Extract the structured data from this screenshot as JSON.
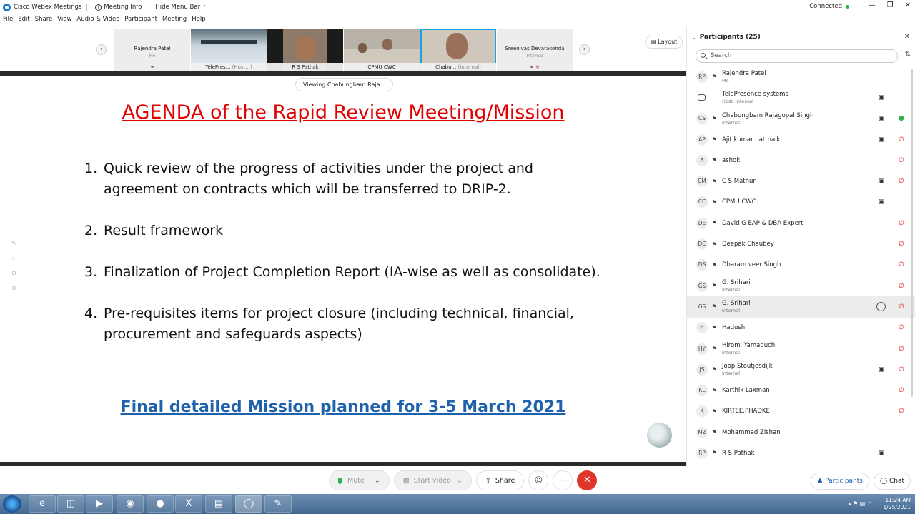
{
  "titlebar": {
    "app_name": "Cisco Webex Meetings",
    "meeting_info": "Meeting Info",
    "hide_menu": "Hide Menu Bar",
    "connection": "Connected"
  },
  "menu": [
    "File",
    "Edit",
    "Share",
    "View",
    "Audio & Video",
    "Participant",
    "Meeting",
    "Help"
  ],
  "filmstrip": {
    "tiles": [
      {
        "name": "Rajendra Patel",
        "sub": "Me"
      },
      {
        "name": "TelePres...",
        "sub": "(Host...)"
      },
      {
        "name": "R S Pathak",
        "sub": ""
      },
      {
        "name": "CPMU CWC",
        "sub": ""
      },
      {
        "name": "Chabu...",
        "sub": "(Internal)"
      },
      {
        "name": "Sreenivas Devarakonda",
        "sub": "Internal"
      }
    ],
    "layout_label": "Layout"
  },
  "viewing_label": "Viewing Chabungbam Raja...",
  "slide": {
    "title": "AGENDA of the Rapid Review Meeting/Mission",
    "items": [
      {
        "num": "1.",
        "text": "Quick review of the progress of activities under the project and agreement on contracts which will be transferred to DRIP-2."
      },
      {
        "num": "2.",
        "text": "Result framework"
      },
      {
        "num": "3.",
        "text": "Finalization of Project Completion Report (IA-wise as well as consolidate)."
      },
      {
        "num": "4.",
        "text": "Pre-requisites items for project closure (including technical, financial, procurement and safeguards aspects)"
      }
    ],
    "footer": "Final detailed Mission planned for 3-5 March 2021"
  },
  "controls": {
    "mute": "Mute",
    "start_video": "Start video",
    "share": "Share"
  },
  "participants": {
    "header": "Participants (25)",
    "search_placeholder": "Search",
    "list": [
      {
        "initials": "RP",
        "name": "Rajendra Patel",
        "sub": "Me",
        "video": false,
        "muted": false
      },
      {
        "initials": "",
        "name": "TelePresence systems",
        "sub": "Host, internal",
        "video": true,
        "muted": false
      },
      {
        "initials": "CS",
        "name": "Chabungbam Rajagopal Singh",
        "sub": "Internal",
        "video": true,
        "muted": false,
        "unmuted": true
      },
      {
        "initials": "AP",
        "name": "Ajit kumar pattnaik",
        "sub": "",
        "video": true,
        "muted": true
      },
      {
        "initials": "A",
        "name": "ashok",
        "sub": "",
        "video": false,
        "muted": true
      },
      {
        "initials": "CM",
        "name": "C S Mathur",
        "sub": "",
        "video": true,
        "muted": true
      },
      {
        "initials": "CC",
        "name": "CPMU CWC",
        "sub": "",
        "video": true,
        "muted": false
      },
      {
        "initials": "DE",
        "name": "David G EAP & DBA Expert",
        "sub": "",
        "video": false,
        "muted": true
      },
      {
        "initials": "DC",
        "name": "Deepak Chaubey",
        "sub": "",
        "video": false,
        "muted": true
      },
      {
        "initials": "DS",
        "name": "Dharam veer Singh",
        "sub": "",
        "video": false,
        "muted": true
      },
      {
        "initials": "GS",
        "name": "G. Srihari",
        "sub": "Internal",
        "video": false,
        "muted": true
      },
      {
        "initials": "GS",
        "name": "G. Srihari",
        "sub": "Internal",
        "video": false,
        "muted": true,
        "chat": true,
        "highlight": true
      },
      {
        "initials": "H",
        "name": "Hadush",
        "sub": "",
        "video": false,
        "muted": true
      },
      {
        "initials": "HY",
        "name": "Hiromi Yamaguchi",
        "sub": "Internal",
        "video": false,
        "muted": true
      },
      {
        "initials": "JS",
        "name": "Joop Stoutjesdijk",
        "sub": "Internal",
        "video": true,
        "muted": true
      },
      {
        "initials": "KL",
        "name": "Karthik Laxman",
        "sub": "",
        "video": false,
        "muted": true
      },
      {
        "initials": "K",
        "name": "KIRTEE.PHADKE",
        "sub": "",
        "video": false,
        "muted": true
      },
      {
        "initials": "MZ",
        "name": "Mohammad Zishan",
        "sub": "",
        "video": false,
        "muted": false
      },
      {
        "initials": "RP",
        "name": "R S Pathak",
        "sub": "",
        "video": true,
        "muted": false
      }
    ]
  },
  "panel_footer": {
    "participants": "Participants",
    "chat": "Chat"
  },
  "taskbar": {
    "time": "11:24 AM",
    "date": "1/25/2021"
  }
}
